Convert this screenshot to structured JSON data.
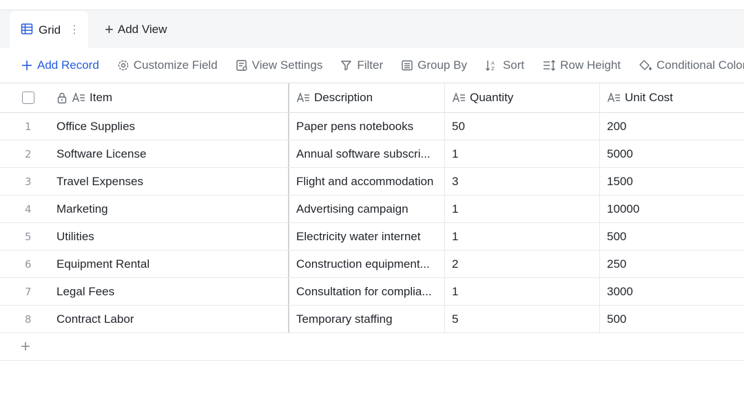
{
  "views": {
    "active": {
      "label": "Grid",
      "icon": "grid-view-icon"
    },
    "add_view_label": "Add View"
  },
  "toolbar": {
    "add_record": "Add Record",
    "customize_field": "Customize Field",
    "view_settings": "View Settings",
    "filter": "Filter",
    "group_by": "Group By",
    "sort": "Sort",
    "row_height": "Row Height",
    "conditional_color": "Conditional Color"
  },
  "colors": {
    "accent": "#245bdb",
    "text": "#1f2329",
    "muted": "#646a73"
  },
  "table": {
    "columns": [
      "Item",
      "Description",
      "Quantity",
      "Unit Cost"
    ],
    "rows": [
      {
        "n": "1",
        "item": "Office Supplies",
        "description": "Paper pens notebooks",
        "quantity": "50",
        "unit_cost": "200"
      },
      {
        "n": "2",
        "item": "Software License",
        "description": "Annual software subscri...",
        "quantity": "1",
        "unit_cost": "5000"
      },
      {
        "n": "3",
        "item": "Travel Expenses",
        "description": "Flight and accommodation",
        "quantity": "3",
        "unit_cost": "1500"
      },
      {
        "n": "4",
        "item": "Marketing",
        "description": "Advertising campaign",
        "quantity": "1",
        "unit_cost": "10000"
      },
      {
        "n": "5",
        "item": "Utilities",
        "description": "Electricity water internet",
        "quantity": "1",
        "unit_cost": "500"
      },
      {
        "n": "6",
        "item": "Equipment Rental",
        "description": "Construction equipment...",
        "quantity": "2",
        "unit_cost": "250"
      },
      {
        "n": "7",
        "item": "Legal Fees",
        "description": "Consultation for complia...",
        "quantity": "1",
        "unit_cost": "3000"
      },
      {
        "n": "8",
        "item": "Contract Labor",
        "description": "Temporary staffing",
        "quantity": "5",
        "unit_cost": "500"
      }
    ]
  }
}
